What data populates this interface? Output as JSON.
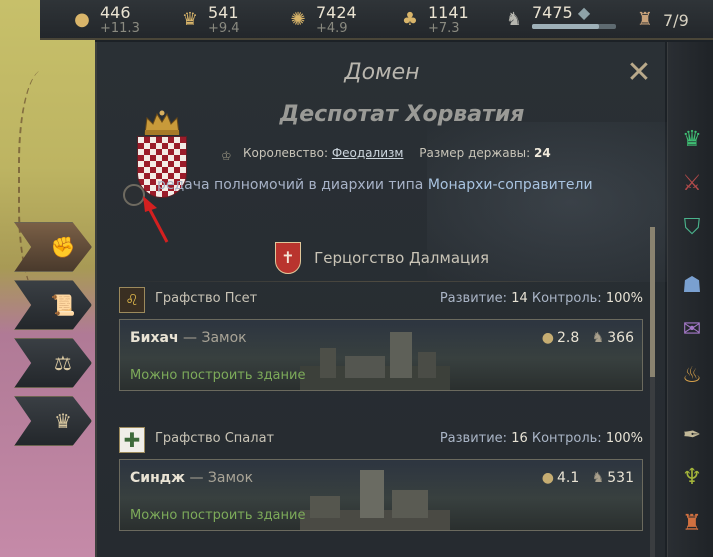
{
  "topbar": {
    "gold": {
      "icon": "gold-coins-icon",
      "value": "446",
      "change": "+11.3"
    },
    "prestige": {
      "icon": "crown-icon",
      "value": "541",
      "change": "+9.4"
    },
    "piety": {
      "icon": "piety-icon",
      "value": "7424",
      "change": "+4.9"
    },
    "renown": {
      "icon": "dynasty-tree-icon",
      "value": "1141",
      "change": "+7.3"
    },
    "troops": {
      "icon": "soldiers-icon",
      "value": "7475",
      "level": 0.8
    },
    "domain_limit": {
      "icon": "castle-icon",
      "value": "7/9"
    }
  },
  "panel": {
    "title": "Домен",
    "realm_name": "Деспотат Хорватия",
    "info": {
      "kingdom_label": "Королевство:",
      "kingdom_value": "Феодализм",
      "size_label": "Размер державы:",
      "size_value": "24"
    },
    "rule_text": "редача полномочий в диархии типа",
    "rule_highlight": "Монархи-соправители",
    "duchy": {
      "name": "Герцогство Далмация"
    },
    "counties": [
      {
        "name": "Графство Псет",
        "dev_label": "Развитие:",
        "dev_value": "14",
        "control_label": "Контроль:",
        "control_value": "100%",
        "holding_name": "Бихач",
        "holding_type": "— Замок",
        "gold": "2.8",
        "levies": "366",
        "build": "Можно построить здание"
      },
      {
        "name": "Графство Спалат",
        "dev_label": "Развитие:",
        "dev_value": "16",
        "control_label": "Контроль:",
        "control_value": "100%",
        "holding_name": "Синдж",
        "holding_type": "— Замок",
        "gold": "4.1",
        "levies": "531",
        "build": "Можно построить здание"
      }
    ]
  },
  "colors": {
    "accent_gold": "#d9b56a",
    "link_blue": "#a8c3e0",
    "build_green": "#7dab5a",
    "shield_red": "#9b1c2a"
  }
}
